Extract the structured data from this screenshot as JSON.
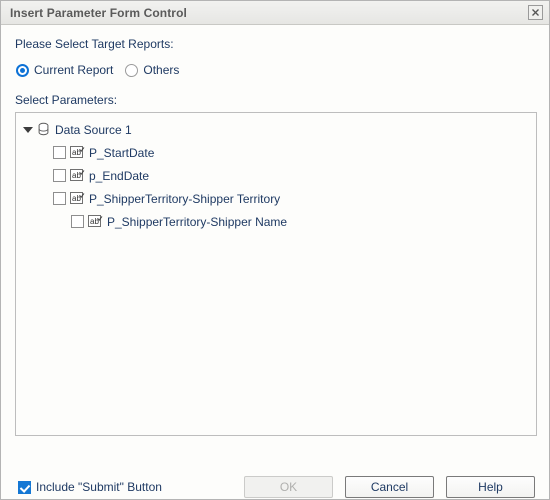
{
  "window": {
    "title": "Insert Parameter Form Control",
    "close_icon": "close-icon",
    "close_glyph": "✕"
  },
  "form": {
    "target_reports_label": "Please Select Target Reports:",
    "radio_options": [
      {
        "label": "Current Report",
        "selected": true
      },
      {
        "label": "Others",
        "selected": false
      }
    ],
    "select_parameters_label": "Select Parameters:"
  },
  "tree": {
    "nodes": [
      {
        "label": "Data Source 1",
        "level": 1,
        "type": "datasource",
        "icon": "database-icon",
        "expanded": true,
        "twisty": "triangle-down-icon"
      },
      {
        "label": "P_StartDate",
        "level": 2,
        "type": "parameter",
        "icon": "parameter-ab-icon",
        "checked": false
      },
      {
        "label": "p_EndDate",
        "level": 2,
        "type": "parameter",
        "icon": "parameter-ab-icon",
        "checked": false
      },
      {
        "label": "P_ShipperTerritory-Shipper Territory",
        "level": 2,
        "type": "parameter",
        "icon": "parameter-ab-icon",
        "checked": false
      },
      {
        "label": "P_ShipperTerritory-Shipper Name",
        "level": 3,
        "type": "parameter",
        "icon": "parameter-ab-icon",
        "checked": false
      }
    ]
  },
  "footer": {
    "include_submit_label": "Include \"Submit\" Button",
    "include_submit_checked": true,
    "buttons": [
      {
        "label": "OK",
        "disabled": true
      },
      {
        "label": "Cancel",
        "disabled": false
      },
      {
        "label": "Help",
        "disabled": false
      }
    ]
  },
  "colors": {
    "text": "#1f3a63",
    "accent": "#1477d4",
    "radio_accent": "#0d72d6",
    "title_text": "#5a5a5a",
    "panel_border": "#bdbdbd",
    "dialog_bg": "#fdfdfb"
  }
}
